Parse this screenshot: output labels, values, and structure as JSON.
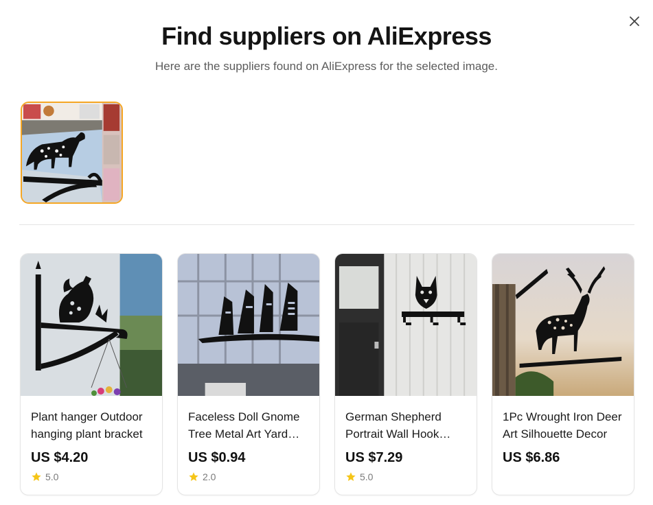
{
  "dialog": {
    "title": "Find suppliers on AliExpress",
    "subtitle": "Here are the suppliers found on AliExpress for the selected image.",
    "close_icon": "close-icon"
  },
  "selected_image": {
    "description_icon": "dalmatian-plant-hanger-photo",
    "border_color": "#f5a623"
  },
  "products": [
    {
      "title": "Plant hanger Outdoor hanging plant bracket",
      "price": "US $4.20",
      "rating": "5.0",
      "image_icon": "rooster-plant-hanger-photo"
    },
    {
      "title": "Faceless Doll Gnome Tree Metal Art Yard Decor",
      "price": "US $0.94",
      "rating": "2.0",
      "image_icon": "gnome-branch-metal-art-photo"
    },
    {
      "title": "German Shepherd Portrait Wall Hook Metal",
      "price": "US $7.29",
      "rating": "5.0",
      "image_icon": "german-shepherd-wall-hook-photo"
    },
    {
      "title": "1Pc Wrought Iron Deer Art Silhouette Decor",
      "price": "US $6.86",
      "rating": null,
      "image_icon": "deer-silhouette-photo"
    }
  ],
  "colors": {
    "star": "#f5c518",
    "accent_border": "#f5a623"
  }
}
